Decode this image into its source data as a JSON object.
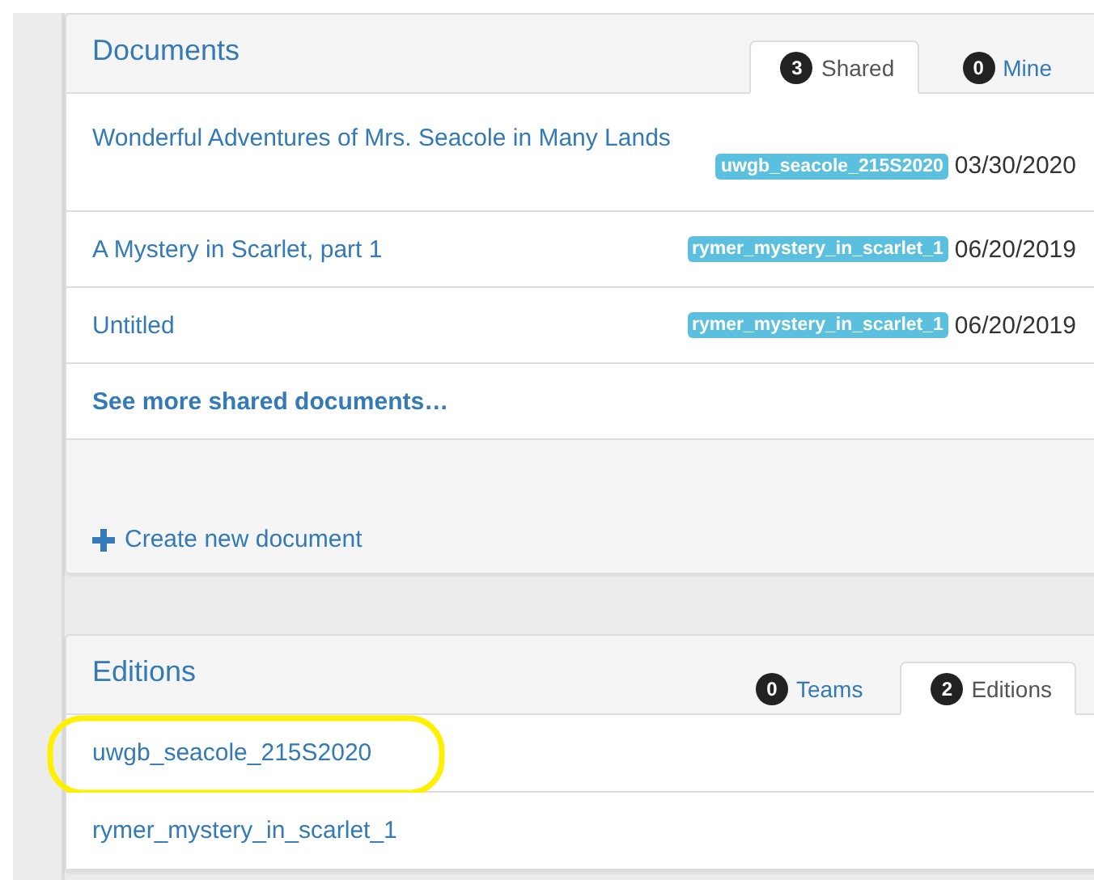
{
  "documents": {
    "title": "Documents",
    "tabs": [
      {
        "count": "3",
        "label": "Shared",
        "selected": true
      },
      {
        "count": "0",
        "label": "Mine",
        "selected": false
      }
    ],
    "rows": [
      {
        "title": "Wonderful Adventures of Mrs. Seacole in Many Lands",
        "tag": "uwgb_seacole_215S2020",
        "date": "03/30/2020",
        "wrapped": true
      },
      {
        "title": "A Mystery in Scarlet, part 1",
        "tag": "rymer_mystery_in_scarlet_1",
        "date": "06/20/2019",
        "wrapped": false
      },
      {
        "title": "Untitled",
        "tag": "rymer_mystery_in_scarlet_1",
        "date": "06/20/2019",
        "wrapped": false
      }
    ],
    "more_link": "See more shared documents…",
    "create_link": "Create new document"
  },
  "editions": {
    "title": "Editions",
    "tabs": [
      {
        "count": "0",
        "label": "Teams",
        "selected": false
      },
      {
        "count": "2",
        "label": "Editions",
        "selected": true
      }
    ],
    "items": [
      {
        "label": "uwgb_seacole_215S2020",
        "highlighted": true
      },
      {
        "label": "rymer_mystery_in_scarlet_1",
        "highlighted": false
      }
    ]
  }
}
